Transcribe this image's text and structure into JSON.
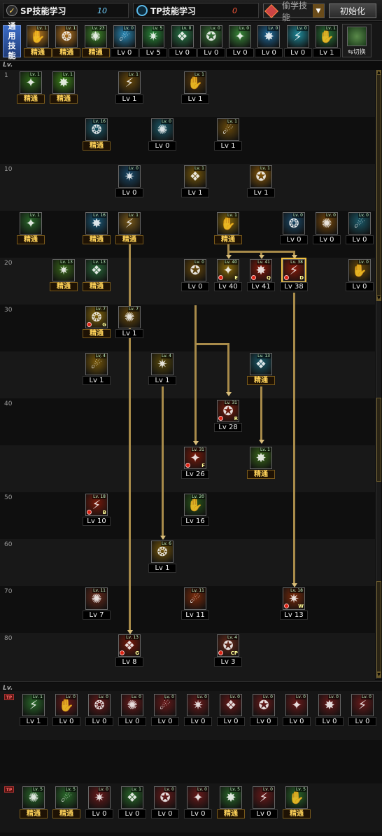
{
  "header": {
    "sp_label": "SP技能学习",
    "sp_value": "10",
    "tp_label": "TP技能学习",
    "tp_value": "0",
    "dropdown_label": "偷学技能",
    "reset_label": "初始化"
  },
  "common": {
    "label": "通用技能",
    "swap_label": "切换",
    "skills": [
      {
        "name": "common-skill-1",
        "lv": "Lv. 1",
        "caption": "精通",
        "mastered": true,
        "color": "#b87a1e"
      },
      {
        "name": "common-skill-2",
        "lv": "Lv. 1",
        "caption": "精通",
        "mastered": true,
        "color": "#b8761e"
      },
      {
        "name": "common-skill-3",
        "lv": "Lv. 23",
        "caption": "精通",
        "mastered": true,
        "color": "#3f8a2a"
      },
      {
        "name": "common-skill-4",
        "lv": "Lv. 0",
        "caption": "Lv 0",
        "mastered": false,
        "color": "#2a8ab8"
      },
      {
        "name": "common-skill-5",
        "lv": "Lv. 5",
        "caption": "Lv 5",
        "mastered": false,
        "color": "#2a8a3a"
      },
      {
        "name": "common-skill-6",
        "lv": "Lv. 0",
        "caption": "Lv 0",
        "mastered": false,
        "color": "#2a7a4a"
      },
      {
        "name": "common-skill-7",
        "lv": "Lv. 0",
        "caption": "Lv 0",
        "mastered": false,
        "color": "#3a7a3a"
      },
      {
        "name": "common-skill-8",
        "lv": "Lv. 0",
        "caption": "Lv 0",
        "mastered": false,
        "color": "#3a8a3a"
      },
      {
        "name": "common-skill-9",
        "lv": "Lv. 0",
        "caption": "Lv 0",
        "mastered": false,
        "color": "#1f6a9a"
      },
      {
        "name": "common-skill-10",
        "lv": "Lv. 0",
        "caption": "Lv 0",
        "mastered": false,
        "color": "#1f8a9a"
      },
      {
        "name": "common-skill-11",
        "lv": "Lv. 1",
        "caption": "Lv 1",
        "mastered": false,
        "color": "#2a7a3a"
      }
    ]
  },
  "tree": {
    "lv_header": "Lv.",
    "row_levels": [
      "1",
      "",
      "10",
      "",
      "20",
      "30",
      "",
      "40",
      "",
      "50",
      "60",
      "70",
      "80"
    ],
    "skills": [
      {
        "row": 0,
        "col": 0,
        "lv": "Lv. 1",
        "caption": "精通",
        "mastered": true,
        "color": "#2f6a1a"
      },
      {
        "row": 0,
        "col": 1,
        "lv": "Lv. 1",
        "caption": "精通",
        "mastered": true,
        "color": "#3f8a1a"
      },
      {
        "row": 0,
        "col": 3,
        "lv": "Lv. 1",
        "caption": "Lv 1",
        "mastered": false,
        "color": "#6a4a0a"
      },
      {
        "row": 0,
        "col": 5,
        "lv": "Lv. 1",
        "caption": "Lv 1",
        "mastered": false,
        "color": "#5a3a0a"
      },
      {
        "row": 1,
        "col": 2,
        "lv": "Lv. 16",
        "caption": "精通",
        "mastered": true,
        "color": "#1a5a6a"
      },
      {
        "row": 1,
        "col": 4,
        "lv": "Lv. 0",
        "caption": "Lv 0",
        "mastered": false,
        "color": "#1a5a6a"
      },
      {
        "row": 1,
        "col": 6,
        "lv": "Lv. 1",
        "caption": "Lv 1",
        "mastered": false,
        "color": "#6a4a0a"
      },
      {
        "row": 2,
        "col": 3,
        "lv": "Lv. 0",
        "caption": "Lv 0",
        "mastered": false,
        "color": "#1a4a6a"
      },
      {
        "row": 2,
        "col": 5,
        "lv": "Lv. 1",
        "caption": "Lv 1",
        "mastered": false,
        "color": "#7a5a0a"
      },
      {
        "row": 2,
        "col": 7,
        "lv": "Lv. 1",
        "caption": "Lv 1",
        "mastered": false,
        "color": "#8a5a0a"
      },
      {
        "row": 3,
        "col": 0,
        "lv": "Lv. 1",
        "caption": "精通",
        "mastered": true,
        "color": "#2a6a2a"
      },
      {
        "row": 3,
        "col": 2,
        "lv": "Lv. 16",
        "caption": "精通",
        "mastered": true,
        "color": "#1a5a7a"
      },
      {
        "row": 3,
        "col": 3,
        "lv": "Lv. 1",
        "caption": "精通",
        "mastered": true,
        "color": "#7a5a1a"
      },
      {
        "row": 3,
        "col": 6,
        "lv": "Lv. 1",
        "caption": "精通",
        "mastered": true,
        "color": "#8a6a0a"
      },
      {
        "row": 3,
        "col": 8,
        "lv": "Lv. 0",
        "caption": "Lv 0",
        "mastered": false,
        "color": "#1a4a6a"
      },
      {
        "row": 3,
        "col": 9,
        "lv": "Lv. 0",
        "caption": "Lv 0",
        "mastered": false,
        "color": "#7a4a0a"
      },
      {
        "row": 3,
        "col": 10,
        "lv": "Lv. 0",
        "caption": "Lv 0",
        "mastered": false,
        "color": "#1a5a6a"
      },
      {
        "row": 4,
        "col": 1,
        "lv": "Lv. 13",
        "caption": "精通",
        "mastered": true,
        "color": "#3a6a1a"
      },
      {
        "row": 4,
        "col": 2,
        "lv": "Lv. 13",
        "caption": "精通",
        "mastered": true,
        "color": "#2a6a3a"
      },
      {
        "row": 4,
        "col": 5,
        "lv": "Lv. 0",
        "caption": "Lv 0",
        "mastered": false,
        "color": "#6a4a0a"
      },
      {
        "row": 4,
        "col": 6,
        "lv": "Lv. 40",
        "caption": "Lv 40",
        "mastered": false,
        "color": "#8a6a0a",
        "key": "E"
      },
      {
        "row": 4,
        "col": 7,
        "lv": "Lv. 41",
        "caption": "Lv 41",
        "mastered": false,
        "color": "#8a1a0a",
        "key": "Q"
      },
      {
        "row": 4,
        "col": 8,
        "lv": "Lv. 38",
        "caption": "Lv 38",
        "mastered": false,
        "color": "#8a1a0a",
        "key": "D",
        "selected": true
      },
      {
        "row": 4,
        "col": 10,
        "lv": "Lv. 0",
        "caption": "Lv 0",
        "mastered": false,
        "color": "#6a4a0a"
      },
      {
        "row": 5,
        "col": 2,
        "lv": "Lv. 7",
        "caption": "精通",
        "mastered": true,
        "color": "#8a6a0a",
        "key": "G"
      },
      {
        "row": 5,
        "col": 3,
        "lv": "Lv. 7",
        "caption": "Lv 1",
        "mastered": false,
        "color": "#6a4a0a"
      },
      {
        "row": 6,
        "col": 2,
        "lv": "Lv. 4",
        "caption": "Lv 1",
        "mastered": false,
        "color": "#7a5a0a"
      },
      {
        "row": 6,
        "col": 4,
        "lv": "Lv. 4",
        "caption": "Lv 1",
        "mastered": false,
        "color": "#5a4a0a"
      },
      {
        "row": 6,
        "col": 7,
        "lv": "Lv. 13",
        "caption": "精通",
        "mastered": true,
        "color": "#1a5a6a"
      },
      {
        "row": 7,
        "col": 6,
        "lv": "Lv. 31",
        "caption": "Lv 28",
        "mastered": false,
        "color": "#7a1a0a",
        "key": "R"
      },
      {
        "row": 8,
        "col": 5,
        "lv": "Lv. 31",
        "caption": "Lv 26",
        "mastered": false,
        "color": "#7a1a0a",
        "key": "F"
      },
      {
        "row": 8,
        "col": 7,
        "lv": "Lv. 1",
        "caption": "精通",
        "mastered": true,
        "color": "#3a6a1a"
      },
      {
        "row": 9,
        "col": 2,
        "lv": "Lv. 18",
        "caption": "Lv 10",
        "mastered": false,
        "color": "#7a1a0a",
        "key": "B"
      },
      {
        "row": 9,
        "col": 5,
        "lv": "Lv. 20",
        "caption": "Lv 16",
        "mastered": false,
        "color": "#2a5a1a"
      },
      {
        "row": 10,
        "col": 4,
        "lv": "Lv. 6",
        "caption": "Lv 1",
        "mastered": false,
        "color": "#7a5a0a"
      },
      {
        "row": 11,
        "col": 2,
        "lv": "Lv. 11",
        "caption": "Lv 7",
        "mastered": false,
        "color": "#6a2a1a"
      },
      {
        "row": 11,
        "col": 5,
        "lv": "Lv. 11",
        "caption": "Lv 11",
        "mastered": false,
        "color": "#7a2a0a"
      },
      {
        "row": 11,
        "col": 8,
        "lv": "Lv. 18",
        "caption": "Lv 13",
        "mastered": false,
        "color": "#7a2a0a",
        "key": "W"
      },
      {
        "row": 12,
        "col": 3,
        "lv": "Lv. 13",
        "caption": "Lv 8",
        "mastered": false,
        "color": "#7a1a0a",
        "key": "G"
      },
      {
        "row": 12,
        "col": 6,
        "lv": "Lv. 4",
        "caption": "Lv 3",
        "mastered": false,
        "color": "#6a2a1a",
        "key": "CP"
      }
    ]
  },
  "tp": {
    "lv_header": "Lv.",
    "tag": "TP",
    "row1": [
      {
        "lv": "Lv. 1",
        "caption": "Lv 1",
        "mastered": false,
        "color": "#2a6a2a"
      },
      {
        "lv": "Lv. 0",
        "caption": "Lv 0",
        "mastered": false,
        "color": "#6a1a1a"
      },
      {
        "lv": "Lv. 0",
        "caption": "Lv 0",
        "mastered": false,
        "color": "#6a1a1a"
      },
      {
        "lv": "Lv. 0",
        "caption": "Lv 0",
        "mastered": false,
        "color": "#6a1a1a"
      },
      {
        "lv": "Lv. 0",
        "caption": "Lv 0",
        "mastered": false,
        "color": "#6a1a1a"
      },
      {
        "lv": "Lv. 0",
        "caption": "Lv 0",
        "mastered": false,
        "color": "#6a1a1a"
      },
      {
        "lv": "Lv. 0",
        "caption": "Lv 0",
        "mastered": false,
        "color": "#6a1a1a"
      },
      {
        "lv": "Lv. 0",
        "caption": "Lv 0",
        "mastered": false,
        "color": "#6a1a1a"
      },
      {
        "lv": "Lv. 0",
        "caption": "Lv 0",
        "mastered": false,
        "color": "#6a1a1a"
      },
      {
        "lv": "Lv. 0",
        "caption": "Lv 0",
        "mastered": false,
        "color": "#6a1a1a"
      },
      {
        "lv": "Lv. 0",
        "caption": "Lv 0",
        "mastered": false,
        "color": "#6a1a1a"
      }
    ],
    "row2": [
      {
        "lv": "Lv. 5",
        "caption": "精通",
        "mastered": true,
        "color": "#2a6a2a"
      },
      {
        "lv": "Lv. 5",
        "caption": "精通",
        "mastered": true,
        "color": "#2a6a2a"
      },
      {
        "lv": "Lv. 0",
        "caption": "Lv 0",
        "mastered": false,
        "color": "#6a1a1a"
      },
      {
        "lv": "Lv. 1",
        "caption": "Lv 0",
        "mastered": false,
        "color": "#2a6a2a"
      },
      {
        "lv": "Lv. 0",
        "caption": "Lv 0",
        "mastered": false,
        "color": "#6a1a1a"
      },
      {
        "lv": "Lv. 0",
        "caption": "Lv 0",
        "mastered": false,
        "color": "#6a1a1a"
      },
      {
        "lv": "Lv. 5",
        "caption": "精通",
        "mastered": true,
        "color": "#2a6a2a"
      },
      {
        "lv": "Lv. 0",
        "caption": "Lv 0",
        "mastered": false,
        "color": "#6a1a1a"
      },
      {
        "lv": "Lv. 5",
        "caption": "精通",
        "mastered": true,
        "color": "#2a6a2a"
      }
    ]
  }
}
